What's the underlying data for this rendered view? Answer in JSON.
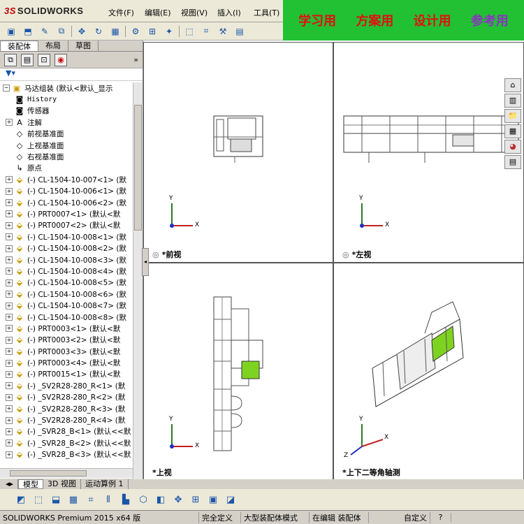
{
  "app": {
    "logo_prefix": "3S",
    "logo_text": "SOLIDWORKS"
  },
  "menus": [
    "文件(F)",
    "编辑(E)",
    "视图(V)",
    "插入(I)",
    "工具(T)"
  ],
  "banner": [
    "学习用",
    "方案用",
    "设计用",
    "参考用"
  ],
  "left_tabs": [
    "装配体",
    "布局",
    "草图"
  ],
  "tree": [
    {
      "label": "马达组装  (默认<默认_显示",
      "kind": "root"
    },
    {
      "label": "History",
      "kind": "sys",
      "mono": true
    },
    {
      "label": "传感器",
      "kind": "sys"
    },
    {
      "label": "注解",
      "kind": "annot"
    },
    {
      "label": "前视基准面",
      "kind": "plane"
    },
    {
      "label": "上视基准面",
      "kind": "plane"
    },
    {
      "label": "右视基准面",
      "kind": "plane"
    },
    {
      "label": "原点",
      "kind": "origin"
    },
    {
      "label": "(-) CL-1504-10-007<1> (默",
      "kind": "part"
    },
    {
      "label": "(-) CL-1504-10-006<1> (默",
      "kind": "part"
    },
    {
      "label": "(-) CL-1504-10-006<2> (默",
      "kind": "part"
    },
    {
      "label": "(-) PRT0007<1> (默认<默",
      "kind": "part"
    },
    {
      "label": "(-) PRT0007<2> (默认<默",
      "kind": "part"
    },
    {
      "label": "(-) CL-1504-10-008<1> (默",
      "kind": "part"
    },
    {
      "label": "(-) CL-1504-10-008<2> (默",
      "kind": "part"
    },
    {
      "label": "(-) CL-1504-10-008<3> (默",
      "kind": "part"
    },
    {
      "label": "(-) CL-1504-10-008<4> (默",
      "kind": "part"
    },
    {
      "label": "(-) CL-1504-10-008<5> (默",
      "kind": "part"
    },
    {
      "label": "(-) CL-1504-10-008<6> (默",
      "kind": "part"
    },
    {
      "label": "(-) CL-1504-10-008<7> (默",
      "kind": "part"
    },
    {
      "label": "(-) CL-1504-10-008<8> (默",
      "kind": "part"
    },
    {
      "label": "(-) PRT0003<1> (默认<默",
      "kind": "part"
    },
    {
      "label": "(-) PRT0003<2> (默认<默",
      "kind": "part"
    },
    {
      "label": "(-) PRT0003<3> (默认<默",
      "kind": "part"
    },
    {
      "label": "(-) PRT0003<4> (默认<默",
      "kind": "part"
    },
    {
      "label": "(-) PRT0015<1> (默认<默",
      "kind": "part"
    },
    {
      "label": "(-) _SV2R28-280_R<1> (默",
      "kind": "part"
    },
    {
      "label": "(-) _SV2R28-280_R<2> (默",
      "kind": "part"
    },
    {
      "label": "(-) _SV2R28-280_R<3> (默",
      "kind": "part"
    },
    {
      "label": "(-) _SV2R28-280_R<4> (默",
      "kind": "part"
    },
    {
      "label": "(-) _SVR28_B<1> (默认<<默",
      "kind": "part"
    },
    {
      "label": "(-) _SVR28_B<2> (默认<<默",
      "kind": "part"
    },
    {
      "label": "(-) _SVR28_B<3> (默认<<默",
      "kind": "part"
    }
  ],
  "views": {
    "front": "*前视",
    "left": "*左视",
    "top": "*上视",
    "iso": "*上下二等角轴测"
  },
  "axis": {
    "x": "X",
    "y": "Y",
    "z": "Z"
  },
  "bottom_tabs": [
    "模型",
    "3D 视图",
    "运动算例 1"
  ],
  "status": [
    "SOLIDWORKS Premium 2015 x64 版",
    "完全定义",
    "大型装配体模式",
    "在编辑 装配体",
    "自定义",
    "?"
  ]
}
